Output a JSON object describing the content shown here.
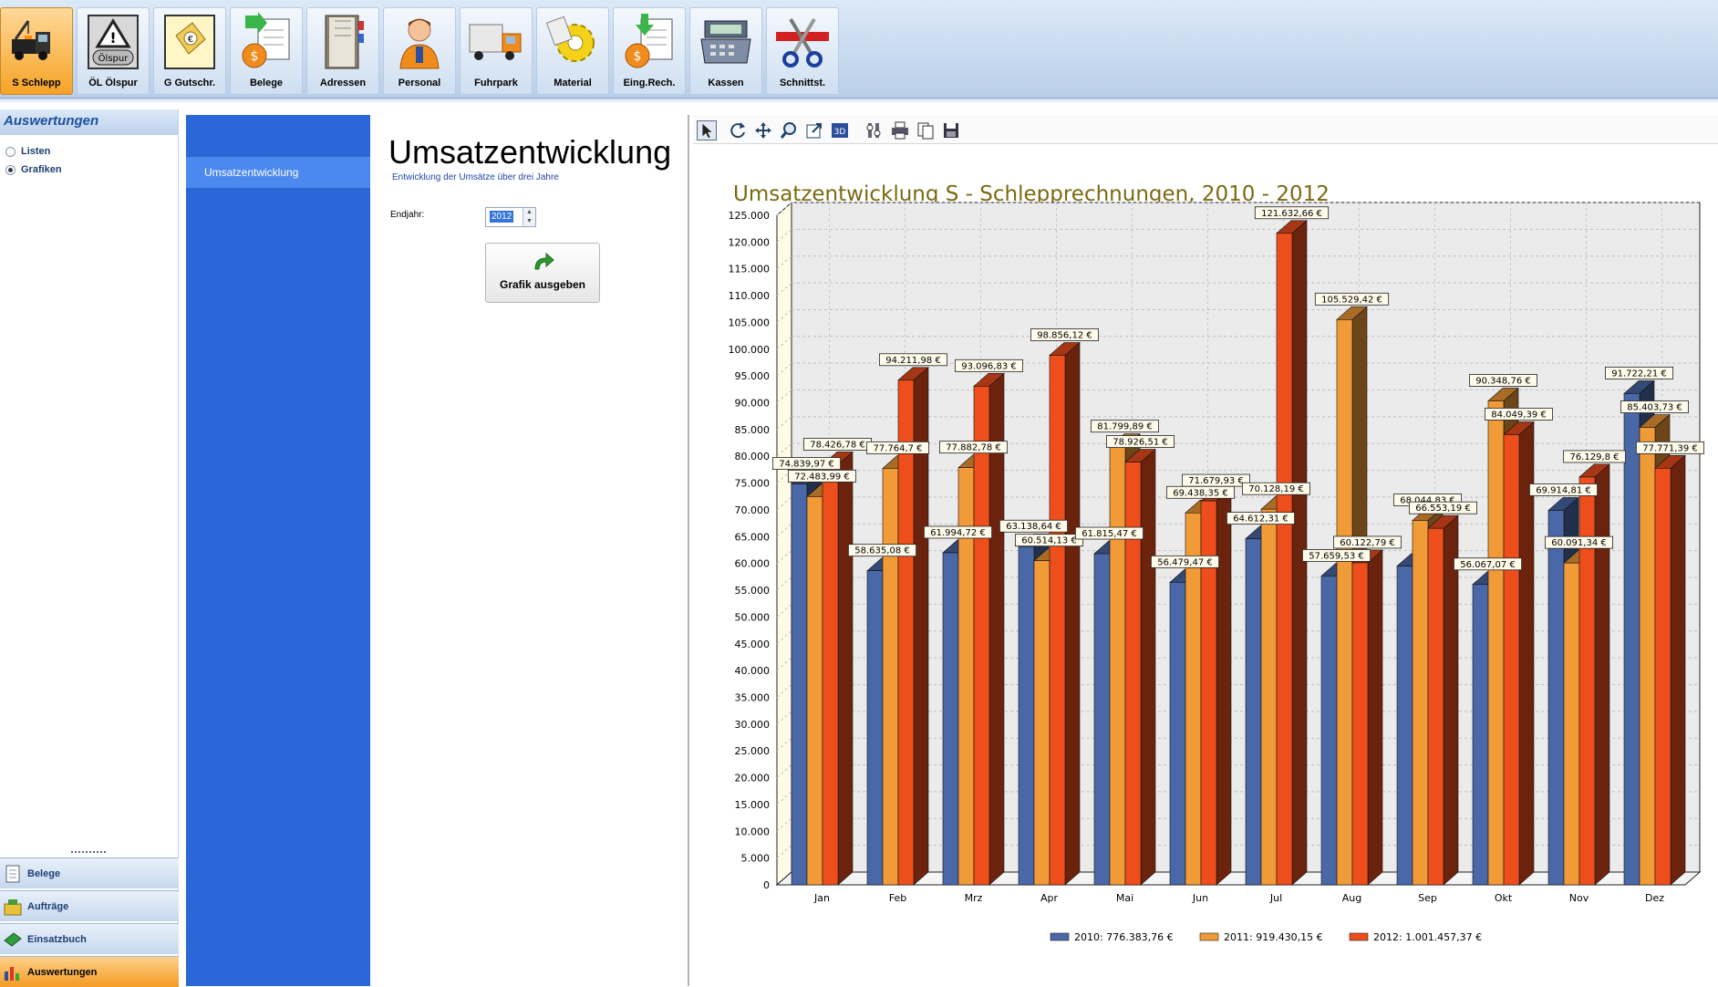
{
  "toolbar": {
    "buttons": [
      {
        "label": "S Schlepp",
        "icon": "tow-truck-icon",
        "active": true
      },
      {
        "label": "ÖL Ölspur",
        "icon": "oil-warning-icon",
        "icon_text": "Ölspur"
      },
      {
        "label": "G Gutschr.",
        "icon": "voucher-icon"
      },
      {
        "label": "Belege",
        "icon": "receipt-money-icon"
      },
      {
        "label": "Adressen",
        "icon": "address-book-icon"
      },
      {
        "label": "Personal",
        "icon": "person-icon"
      },
      {
        "label": "Fuhrpark",
        "icon": "truck-icon"
      },
      {
        "label": "Material",
        "icon": "gear-material-icon"
      },
      {
        "label": "Eing.Rech.",
        "icon": "incoming-invoice-icon"
      },
      {
        "label": "Kassen",
        "icon": "cash-register-icon"
      },
      {
        "label": "Schnittst.",
        "icon": "scissors-icon"
      }
    ]
  },
  "leftnav": {
    "header": "Auswertungen",
    "options": [
      {
        "label": "Listen",
        "checked": false
      },
      {
        "label": "Grafiken",
        "checked": true
      }
    ],
    "bottom_items": [
      {
        "label": "Belege",
        "icon": "document-icon",
        "active": false
      },
      {
        "label": "Aufträge",
        "icon": "orders-icon",
        "active": false
      },
      {
        "label": "Einsatzbuch",
        "icon": "book-icon",
        "active": false
      },
      {
        "label": "Auswertungen",
        "icon": "bar-chart-icon",
        "active": true
      }
    ]
  },
  "section_menu": {
    "item": "Umsatzentwicklung"
  },
  "params": {
    "title": "Umsatzentwicklung",
    "subtitle": "Entwicklung der Umsätze über drei Jahre",
    "endjahr_label": "Endjahr:",
    "endjahr_value": "2012",
    "button_label": "Grafik ausgeben"
  },
  "chart_toolbar": {
    "tools": [
      "pointer-icon",
      "rotate-icon",
      "move-icon",
      "zoom-icon",
      "export-icon",
      "3d-icon",
      "edit-icon",
      "print-icon",
      "copy-icon",
      "save-icon"
    ]
  },
  "chart_data": {
    "type": "bar",
    "title": "Umsatzentwicklung  S - Schlepprechnungen, 2010 - 2012",
    "categories": [
      "Jan",
      "Feb",
      "Mrz",
      "Apr",
      "Mai",
      "Jun",
      "Jul",
      "Aug",
      "Sep",
      "Okt",
      "Nov",
      "Dez"
    ],
    "series": [
      {
        "name": "2010: 776.383,76 €",
        "color": "#4a68a8",
        "values": [
          74839.97,
          58635.08,
          61994.72,
          63138.64,
          61815.47,
          56479.47,
          64612.31,
          57659.53,
          59500,
          56067.07,
          69914.81,
          91722.21
        ],
        "labels": [
          "74.839,97 €",
          "58.635,08 €",
          "61.994,72 €",
          "63.138,64 €",
          "61.815,47 €",
          "56.479,47 €",
          "64.612,31 €",
          "57.659,53 €",
          "",
          "56.067,07 €",
          "69.914,81 €",
          "91.722,21 €"
        ]
      },
      {
        "name": "2011: 919.430,15 €",
        "color": "#f19a38",
        "values": [
          72483.99,
          77764.7,
          77882.78,
          60514.13,
          81799.89,
          69438.35,
          70128.19,
          105529.42,
          68044.83,
          90348.76,
          60091.34,
          85403.73
        ],
        "labels": [
          "72.483,99 €",
          "77.764,7 €",
          "77.882,78 €",
          "60.514,13 €",
          "81.799,89 €",
          "69.438,35 €",
          "70.128,19 €",
          "105.529,42 €",
          "68.044,83 €",
          "90.348,76 €",
          "60.091,34 €",
          "85.403,73 €"
        ]
      },
      {
        "name": "2012: 1.001.457,37 €",
        "color": "#ee4e1c",
        "values": [
          78426.78,
          94211.98,
          93096.83,
          98856.12,
          78926.51,
          71679.93,
          121632.66,
          60122.79,
          66553.19,
          84049.39,
          76129.8,
          77771.39
        ],
        "labels": [
          "78.426,78 €",
          "94.211,98 €",
          "93.096,83 €",
          "98.856,12 €",
          "78.926,51 €",
          "71.679,93 €",
          "121.632,66 €",
          "60.122,79 €",
          "66.553,19 €",
          "84.049,39 €",
          "76.129,8 €",
          "77.771,39 €"
        ]
      }
    ],
    "ylim": [
      0,
      125000
    ],
    "ytick_step": 5000,
    "ytick_labels": [
      "0",
      "5.000",
      "10.000",
      "15.000",
      "20.000",
      "25.000",
      "30.000",
      "35.000",
      "40.000",
      "45.000",
      "50.000",
      "55.000",
      "60.000",
      "65.000",
      "70.000",
      "75.000",
      "80.000",
      "85.000",
      "90.000",
      "95.000",
      "100.000",
      "105.000",
      "110.000",
      "115.000",
      "120.000",
      "125.000"
    ],
    "grid": true,
    "legend": "bottom",
    "xlabel": "",
    "ylabel": ""
  }
}
